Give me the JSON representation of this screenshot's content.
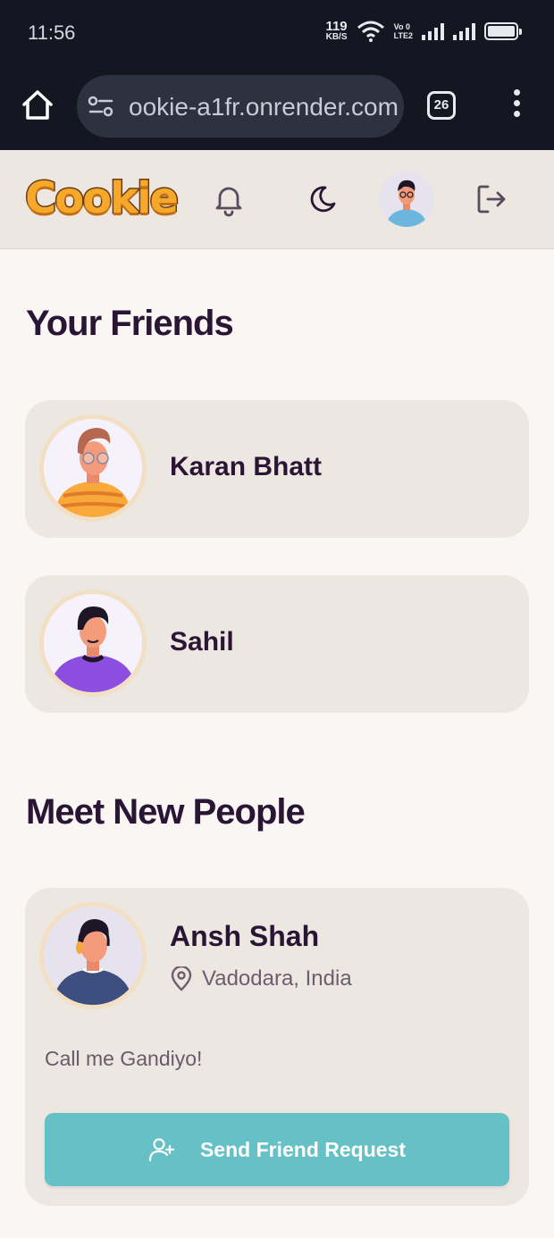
{
  "status_bar": {
    "time": "11:56",
    "net_speed_value": "119",
    "net_speed_unit": "KB/S",
    "volte_top": "Vo 0",
    "volte_bottom": "LTE2"
  },
  "browser": {
    "url": "ookie-a1fr.onrender.com",
    "tab_count": "26"
  },
  "app": {
    "logo_text": "Cookie",
    "accent_color": "#66c1c6",
    "heading_color": "#2a1535",
    "icons": [
      "bell-icon",
      "moon-icon",
      "logout-icon"
    ]
  },
  "friends_section": {
    "title": "Your Friends",
    "friends": [
      {
        "name": "Karan Bhatt",
        "avatar": "avatar-orange-shirt-glasses"
      },
      {
        "name": "Sahil",
        "avatar": "avatar-purple-shirt"
      }
    ]
  },
  "people_section": {
    "title": "Meet New People",
    "people": [
      {
        "name": "Ansh Shah",
        "location": "Vadodara, India",
        "bio": "Call me Gandiyo!",
        "action_label": "Send Friend Request",
        "avatar": "avatar-headphones-navy-shirt"
      }
    ]
  }
}
